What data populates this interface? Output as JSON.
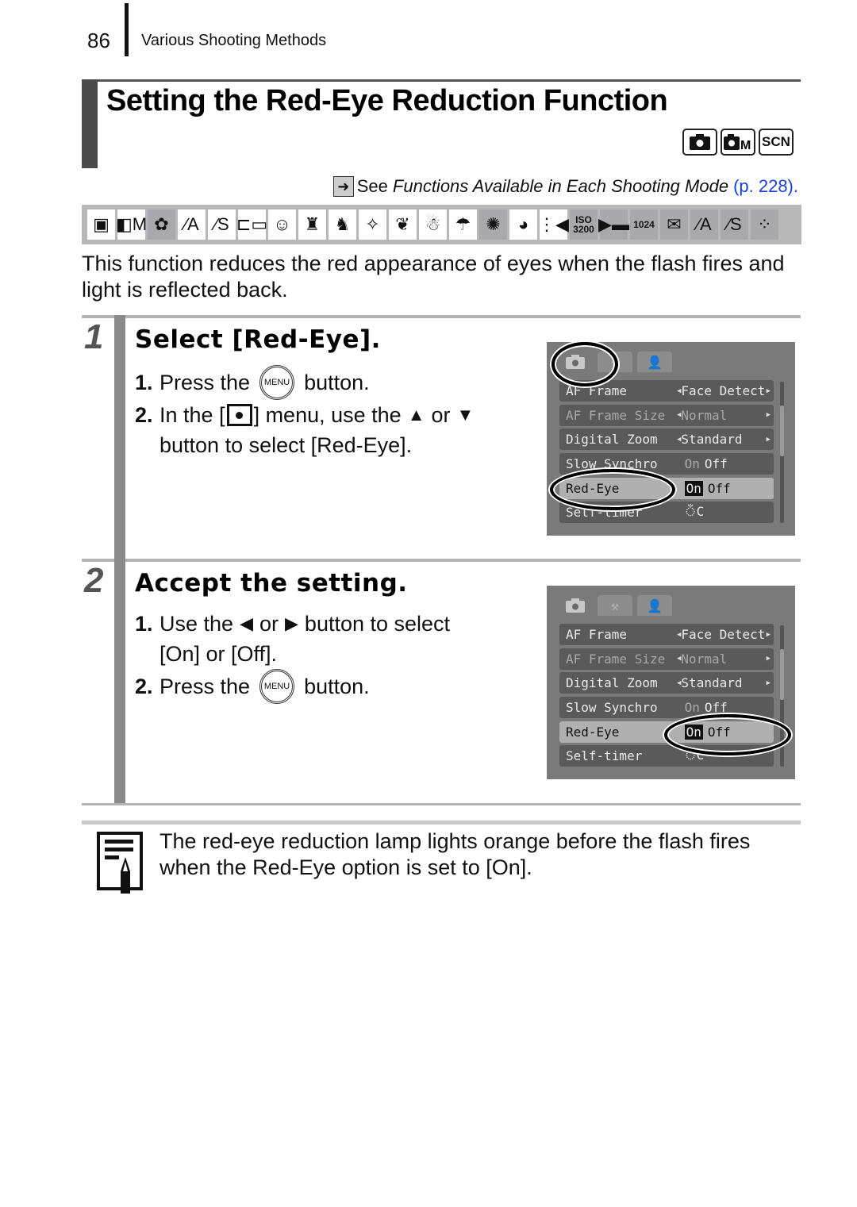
{
  "header": {
    "page_number": "86",
    "section": "Various Shooting Methods"
  },
  "title": "Setting the Red-Eye Reduction Function",
  "mode_icons": [
    {
      "name": "auto-mode-icon",
      "glyph": "■"
    },
    {
      "name": "manual-mode-icon",
      "glyph": "■M"
    },
    {
      "name": "scene-mode-icon",
      "glyph": "SCN"
    }
  ],
  "see_reference": {
    "prefix": "See",
    "italic_text": "Functions Available in Each Shooting Mode",
    "link": "(p. 228)."
  },
  "shooting_mode_strip": [
    {
      "name": "auto",
      "glyph": "▣",
      "available": true
    },
    {
      "name": "manual",
      "glyph": "◧M",
      "available": true
    },
    {
      "name": "digital-macro",
      "glyph": "✿",
      "available": false
    },
    {
      "name": "color-accent",
      "glyph": "∕A",
      "available": true
    },
    {
      "name": "color-swap",
      "glyph": "∕S",
      "available": true
    },
    {
      "name": "stitch-assist",
      "glyph": "⊏▭",
      "available": true
    },
    {
      "name": "portrait",
      "glyph": "☺",
      "available": true
    },
    {
      "name": "night-snapshot",
      "glyph": "♜",
      "available": true
    },
    {
      "name": "kids-pets",
      "glyph": "♞",
      "available": true
    },
    {
      "name": "indoor",
      "glyph": "✧",
      "available": true
    },
    {
      "name": "foliage",
      "glyph": "❦",
      "available": true
    },
    {
      "name": "snow",
      "glyph": "☃",
      "available": true
    },
    {
      "name": "beach",
      "glyph": "☂",
      "available": true
    },
    {
      "name": "fireworks",
      "glyph": "✺",
      "available": false
    },
    {
      "name": "aquarium",
      "glyph": "◕",
      "available": true
    },
    {
      "name": "underwater",
      "glyph": "⋮◀",
      "available": true
    },
    {
      "name": "iso-3200",
      "glyph": "ISO 3200",
      "available": false
    },
    {
      "name": "movie-standard",
      "glyph": "▶▬",
      "available": false
    },
    {
      "name": "movie-1024",
      "glyph": "1024",
      "available": false
    },
    {
      "name": "movie-email",
      "glyph": "✉",
      "available": false
    },
    {
      "name": "movie-color-accent",
      "glyph": "∕A",
      "available": false
    },
    {
      "name": "movie-color-swap",
      "glyph": "∕S",
      "available": false
    },
    {
      "name": "movie-time-lapse",
      "glyph": "⁘",
      "available": false
    }
  ],
  "intro": "This function reduces the red appearance of eyes when the flash fires and light is reflected back.",
  "steps": [
    {
      "number": "1",
      "title": "Select [Red-Eye].",
      "items": [
        {
          "n": "1.",
          "before": "Press the",
          "button": "MENU",
          "after": "button."
        },
        {
          "n": "2.",
          "before": "In the [",
          "after_icon": "] menu, use the",
          "arrow1": "🡅",
          "or": "or",
          "arrow2": "🡇",
          "cont": "button to select [Red-Eye]."
        }
      ],
      "screen": {
        "tabs": [
          "camera-tab",
          "setup-tab",
          "my-menu-tab"
        ],
        "rows": [
          {
            "label": "AF Frame",
            "value": "Face Detect",
            "arrows": true
          },
          {
            "label": "AF Frame Size",
            "value": "Normal",
            "arrows": true,
            "dim": true
          },
          {
            "label": "Digital Zoom",
            "value": "Standard",
            "arrows": true
          },
          {
            "label": "Slow Synchro",
            "on": "On",
            "off": "Off"
          },
          {
            "label": "Red-Eye",
            "on": "On",
            "off": "Off",
            "selected": true
          },
          {
            "label": "Self-timer",
            "value": "self-timer-icon"
          }
        ]
      }
    },
    {
      "number": "2",
      "title": "Accept the setting.",
      "items": [
        {
          "n": "1.",
          "before": "Use the",
          "arrow1": "🡄",
          "or": "or",
          "arrow2": "🡆",
          "after": "button to select",
          "cont": "[On] or [Off]."
        },
        {
          "n": "2.",
          "before": "Press the",
          "button": "MENU",
          "after": "button."
        }
      ]
    }
  ],
  "note": "The red-eye reduction lamp lights orange before the flash fires when the Red-Eye option is set to [On].",
  "colors": {
    "link": "#1a3fd6",
    "step_bar": "#8a8a8a",
    "screen_bg": "#7a7a7a"
  }
}
